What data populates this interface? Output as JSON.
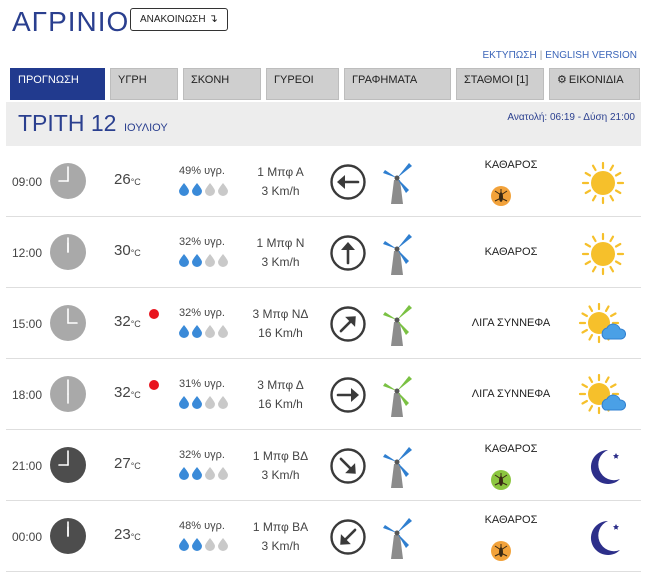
{
  "header": {
    "city": "ΑΓΡΙΝΙΟ",
    "announce_label": "ΑΝΑΚΟΙΝΩΣΗ",
    "announce_arrow": "↴",
    "print_link": "ΕΚΤΥΠΩΣΗ",
    "separator": "|",
    "english_link": "ENGLISH VERSION"
  },
  "tabs": [
    {
      "label": "ΠΡΟΓΝΩΣΗ",
      "active": true
    },
    {
      "label": "ΥΓΡΗ",
      "active": false
    },
    {
      "label": "ΣΚΟΝΗ",
      "active": false
    },
    {
      "label": "ΓΥΡΕΟΙ",
      "active": false
    },
    {
      "label": "ΓΡΑΦΗΜΑΤΑ",
      "active": false
    },
    {
      "label": "ΣΤΑΘΜΟΙ [1]",
      "active": false
    },
    {
      "label": "ΕΙΚΟΝΙΔΙΑ",
      "active": false,
      "icon": "gear-icon"
    }
  ],
  "day": {
    "weekday_date": "ΤΡΙΤΗ 12",
    "month": "ΙΟΥΛΙΟΥ",
    "sun": "Ανατολή: 06:19 - Δύση 21:00"
  },
  "colors": {
    "brand_blue": "#213a8e",
    "tab_grey": "#cfcfcf",
    "heat_dot": "#e8141e",
    "sun_yellow": "#f6c02b",
    "moon_navy": "#2d2f8a",
    "drop_blue": "#3a8ad8",
    "drop_grey": "#c9c9c9",
    "mill_blue": "#2f7fd0",
    "mill_green": "#7ac143"
  },
  "forecast": [
    {
      "time": "09:00",
      "clock": "light",
      "temp": "26",
      "unit": "°C",
      "hot": false,
      "humidity": "49% υγρ.",
      "drops_filled": 2,
      "wind_force": "1 Μπφ Α",
      "wind_speed": "3 Km/h",
      "wind_dir": "arrow-west-icon",
      "mill": "blue",
      "condition": "ΚΑΘΑΡΟΣ",
      "insect": "orange",
      "weather_icon": "sun-icon"
    },
    {
      "time": "12:00",
      "clock": "light",
      "temp": "30",
      "unit": "°C",
      "hot": false,
      "humidity": "32% υγρ.",
      "drops_filled": 2,
      "wind_force": "1 Μπφ Ν",
      "wind_speed": "3 Km/h",
      "wind_dir": "arrow-north-icon",
      "mill": "blue",
      "condition": "ΚΑΘΑΡΟΣ",
      "insect": "",
      "weather_icon": "sun-icon"
    },
    {
      "time": "15:00",
      "clock": "light",
      "temp": "32",
      "unit": "°C",
      "hot": true,
      "humidity": "32% υγρ.",
      "drops_filled": 2,
      "wind_force": "3 Μπφ ΝΔ",
      "wind_speed": "16 Km/h",
      "wind_dir": "arrow-northeast-icon",
      "mill": "green",
      "condition": "ΛΙΓΑ ΣΥΝΝΕΦΑ",
      "insect": "",
      "weather_icon": "sun-cloud-icon"
    },
    {
      "time": "18:00",
      "clock": "light",
      "temp": "32",
      "unit": "°C",
      "hot": true,
      "humidity": "31% υγρ.",
      "drops_filled": 2,
      "wind_force": "3 Μπφ Δ",
      "wind_speed": "16 Km/h",
      "wind_dir": "arrow-east-icon",
      "mill": "green",
      "condition": "ΛΙΓΑ ΣΥΝΝΕΦΑ",
      "insect": "",
      "weather_icon": "sun-cloud-icon"
    },
    {
      "time": "21:00",
      "clock": "dark",
      "temp": "27",
      "unit": "°C",
      "hot": false,
      "humidity": "32% υγρ.",
      "drops_filled": 2,
      "wind_force": "1 Μπφ ΒΔ",
      "wind_speed": "3 Km/h",
      "wind_dir": "arrow-southeast-icon",
      "mill": "blue",
      "condition": "ΚΑΘΑΡΟΣ",
      "insect": "green",
      "weather_icon": "moon-icon"
    },
    {
      "time": "00:00",
      "clock": "dark",
      "temp": "23",
      "unit": "°C",
      "hot": false,
      "humidity": "48% υγρ.",
      "drops_filled": 2,
      "wind_force": "1 Μπφ ΒΑ",
      "wind_speed": "3 Km/h",
      "wind_dir": "arrow-southwest-icon",
      "mill": "blue",
      "condition": "ΚΑΘΑΡΟΣ",
      "insect": "orange",
      "weather_icon": "moon-icon"
    }
  ]
}
